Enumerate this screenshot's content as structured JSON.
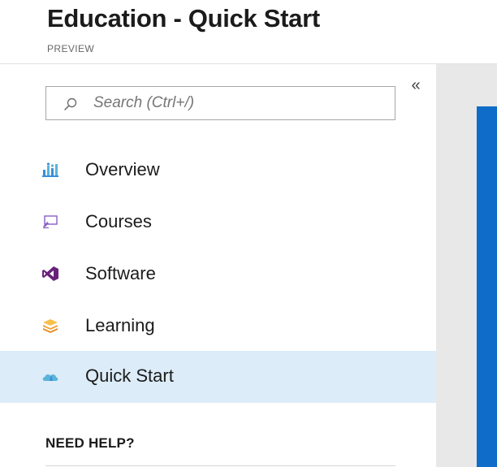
{
  "header": {
    "title": "Education - Quick Start",
    "subtitle": "PREVIEW"
  },
  "sidebar": {
    "collapse_glyph": "«",
    "search": {
      "placeholder": "Search (Ctrl+/)",
      "value": ""
    },
    "items": [
      {
        "label": "Overview",
        "icon": "overview-icon",
        "color": "#3b8fd9"
      },
      {
        "label": "Courses",
        "icon": "courses-icon",
        "color": "#8b5fc4"
      },
      {
        "label": "Software",
        "icon": "visual-studio-icon",
        "color": "#68217a"
      },
      {
        "label": "Learning",
        "icon": "learning-stack-icon",
        "color": "#f2a12e"
      },
      {
        "label": "Quick Start",
        "icon": "quick-start-cloud-icon",
        "color": "#59b4d9",
        "selected": true
      }
    ],
    "help_heading": "NEED HELP?"
  },
  "colors": {
    "selected_background": "#dcecf8",
    "blade_accent": "#0f6cc8",
    "pane_background": "#e8e8e8"
  }
}
